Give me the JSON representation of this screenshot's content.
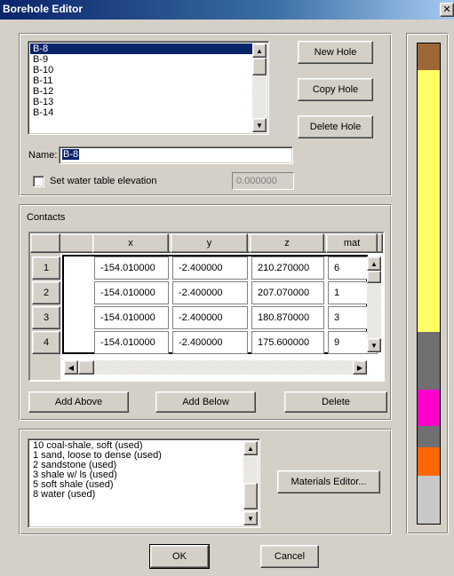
{
  "window": {
    "title": "Borehole Editor",
    "close_label": "✕"
  },
  "holes": {
    "items": [
      "B-8",
      "B-9",
      "B-10",
      "B-11",
      "B-12",
      "B-13",
      "B-14"
    ],
    "selected_index": 0,
    "new_label": "New Hole",
    "copy_label": "Copy Hole",
    "delete_label": "Delete Hole"
  },
  "name": {
    "label": "Name:",
    "value": "B-8"
  },
  "water_table": {
    "label": "Set water table elevation",
    "checked": false,
    "value": "0.000000"
  },
  "contacts": {
    "group_label": "Contacts",
    "columns": [
      "x",
      "y",
      "z",
      "mat"
    ],
    "rows": [
      {
        "num": "1",
        "x": "-154.010000",
        "y": "-2.400000",
        "z": "210.270000",
        "mat": "6"
      },
      {
        "num": "2",
        "x": "-154.010000",
        "y": "-2.400000",
        "z": "207.070000",
        "mat": "1"
      },
      {
        "num": "3",
        "x": "-154.010000",
        "y": "-2.400000",
        "z": "180.870000",
        "mat": "3"
      },
      {
        "num": "4",
        "x": "-154.010000",
        "y": "-2.400000",
        "z": "175.600000",
        "mat": "9"
      }
    ],
    "add_above_label": "Add Above",
    "add_below_label": "Add Below",
    "delete_label": "Delete"
  },
  "materials": {
    "items": [
      "10 coal-shale, soft (used)",
      "1 sand, loose to dense (used)",
      "2 sandstone (used)",
      "3 shale w/ ls (used)",
      "5 soft shale (used)",
      "8 water (used)"
    ],
    "editor_label": "Materials Editor..."
  },
  "footer": {
    "ok_label": "OK",
    "cancel_label": "Cancel"
  },
  "column_colors": [
    {
      "color": "#9c6838",
      "fraction": 0.055
    },
    {
      "color": "#ffff66",
      "fraction": 0.545
    },
    {
      "color": "#707070",
      "fraction": 0.12
    },
    {
      "color": "#ff00cc",
      "fraction": 0.075
    },
    {
      "color": "#707070",
      "fraction": 0.045
    },
    {
      "color": "#ff6600",
      "fraction": 0.06
    },
    {
      "color": "#c8c8c8",
      "fraction": 0.1
    }
  ]
}
